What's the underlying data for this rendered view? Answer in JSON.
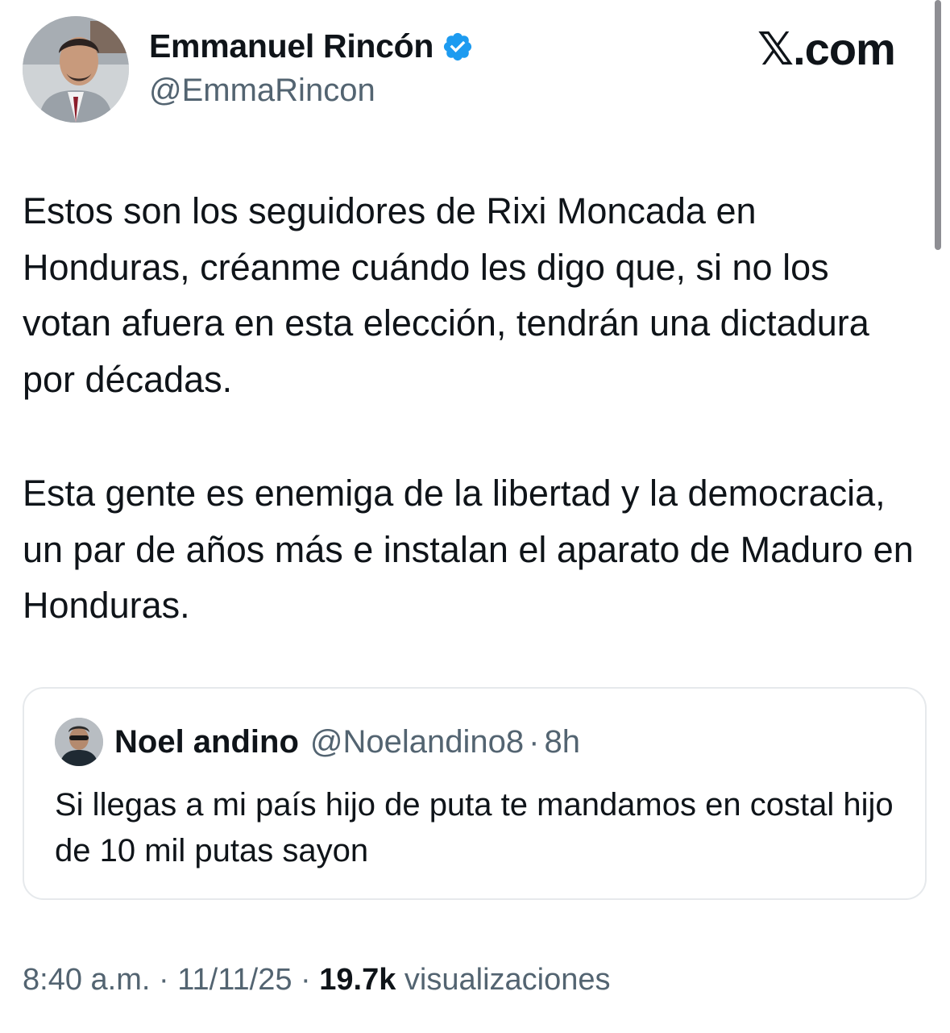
{
  "author": {
    "display_name": "Emmanuel Rincón",
    "handle": "@EmmaRincon",
    "avatar_icon": "profile-photo-man-suit",
    "verified": true,
    "verified_color": "#1d9bf0"
  },
  "brand": {
    "label": "𝕏.com"
  },
  "tweet": {
    "paragraphs": [
      "Estos son los seguidores de Rixi Moncada en Honduras, créanme cuándo les digo que, si no los votan afuera en esta elección, tendrán una dictadura por décadas.",
      "Esta gente es enemiga de la libertad y la democracia, un par de años más e instalan el aparato de Maduro en Honduras."
    ]
  },
  "quote": {
    "display_name": "Noel andino",
    "handle": "@Noelandino8",
    "separator": "·",
    "time": "8h",
    "text": "Si llegas a mi país hijo de puta te mandamos en costal hijo de 10 mil putas sayon",
    "avatar_icon": "profile-photo-man-sunglasses"
  },
  "meta": {
    "time": "8:40 a.m.",
    "separator": " · ",
    "date": "11/11/25",
    "views_count": "19.7k",
    "views_label": "visualizaciones"
  },
  "colors": {
    "text_primary": "#0f1419",
    "text_secondary": "#536471",
    "border": "#e6e9ec"
  }
}
